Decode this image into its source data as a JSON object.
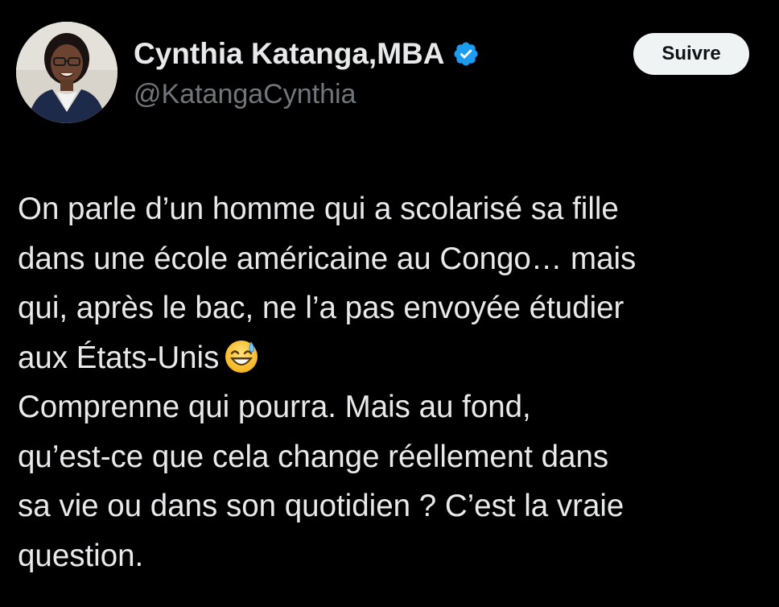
{
  "author": {
    "display_name": "Cynthia Katanga,MBA",
    "handle": "@KatangaCynthia",
    "verified": true,
    "avatar_icon": "profile-photo"
  },
  "follow_button": {
    "label": "Suivre"
  },
  "tweet": {
    "lines": [
      "On parle d’un homme qui a scolarisé sa fille",
      "dans une école américaine au Congo… mais",
      "qui, après le bac, ne l’a pas envoyée étudier",
      "aux États-Unis",
      "Comprenne qui pourra. Mais au fond,",
      "qu’est-ce que cela change réellement dans",
      "sa vie ou dans son quotidien ? C’est la vraie",
      "question."
    ],
    "emoji": "grinning-face-with-sweat-icon"
  },
  "colors": {
    "background": "#000000",
    "text_primary": "#e7e9ea",
    "text_secondary": "#71767b",
    "verified_blue": "#1d9bf0",
    "button_bg": "#eff3f4",
    "button_text": "#0f1419"
  }
}
